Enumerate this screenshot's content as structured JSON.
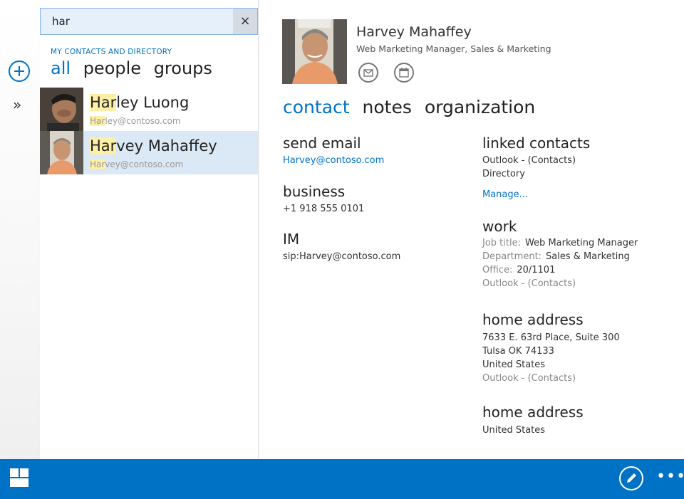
{
  "rail": {
    "add_icon": "plus-circle-icon",
    "expand_label": "»"
  },
  "search": {
    "query": "har",
    "clear_label": "×"
  },
  "scope_label": "MY CONTACTS AND DIRECTORY",
  "filters": [
    "all",
    "people",
    "groups"
  ],
  "results": [
    {
      "name_hl": "Har",
      "name_rest": "ley Luong",
      "email_hl": "Har",
      "email_rest": "ley@contoso.com"
    },
    {
      "name_hl": "Har",
      "name_rest": "vey Mahaffey",
      "email_hl": "Har",
      "email_rest": "vey@contoso.com"
    }
  ],
  "contact": {
    "name": "Harvey Mahaffey",
    "title": "Web Marketing Manager, Sales & Marketing",
    "actions": [
      "email-icon",
      "calendar-icon"
    ],
    "tabs": [
      "contact",
      "notes",
      "organization"
    ],
    "send_email": {
      "heading": "send email",
      "value": "Harvey@contoso.com"
    },
    "business": {
      "heading": "business",
      "value": "+1 918 555 0101"
    },
    "im": {
      "heading": "IM",
      "value": "sip:Harvey@contoso.com"
    },
    "linked": {
      "heading": "linked contacts",
      "source1": "Outlook - (Contacts)",
      "source2": "Directory",
      "manage": "Manage..."
    },
    "work": {
      "heading": "work",
      "job_label": "Job title:",
      "job_value": "Web Marketing Manager",
      "dept_label": "Department:",
      "dept_value": "Sales & Marketing",
      "office_label": "Office:",
      "office_value": "20/1101",
      "source": "Outlook - (Contacts)"
    },
    "home1": {
      "heading": "home address",
      "line1": "7633 E. 63rd Place, Suite 300",
      "line2": "Tulsa OK 74133",
      "line3": "United States",
      "source": "Outlook - (Contacts)"
    },
    "home2": {
      "heading": "home address",
      "line1": "United States"
    }
  },
  "appbar": {
    "more_label": "•••"
  },
  "colors": {
    "accent": "#0072c6",
    "highlight": "#fdf0a6",
    "selected": "#dbe8f6"
  }
}
